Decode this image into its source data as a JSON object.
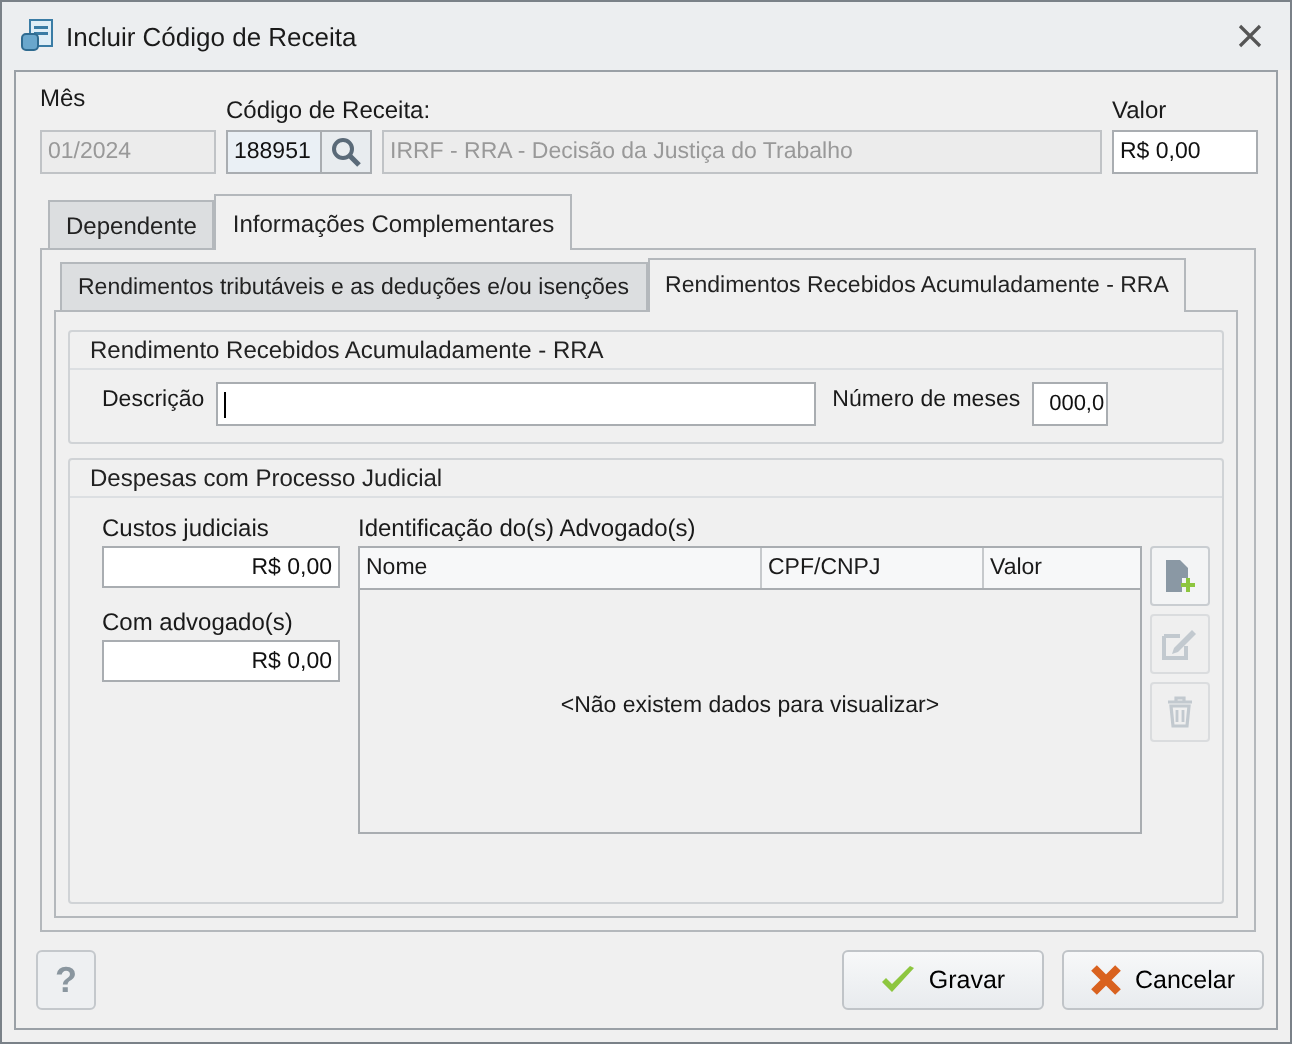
{
  "window": {
    "title": "Incluir Código de Receita"
  },
  "header": {
    "mes": {
      "label": "Mês",
      "value": "01/2024",
      "disabled": true
    },
    "codigo": {
      "label": "Código de Receita:",
      "value": "188951",
      "description": "IRRF - RRA - Decisão da Justiça do Trabalho",
      "description_disabled": true
    },
    "valor": {
      "label": "Valor",
      "value": "R$ 0,00"
    }
  },
  "tabs": [
    {
      "label": "Dependente",
      "selected": false
    },
    {
      "label": "Informações Complementares",
      "selected": true
    }
  ],
  "subtabs": [
    {
      "label": "Rendimentos tributáveis e as deduções e/ou isenções",
      "selected": false
    },
    {
      "label": "Rendimentos Recebidos Acumuladamente - RRA",
      "selected": true
    }
  ],
  "rra_group": {
    "title": "Rendimento Recebidos Acumuladamente - RRA",
    "descricao_label": "Descrição",
    "meses_label": "Número de meses",
    "meses_value": "000,0"
  },
  "despesas_group": {
    "title": "Despesas com Processo Judicial",
    "custos": {
      "label": "Custos judiciais",
      "value": "R$ 0,00"
    },
    "advogado": {
      "label": "Com advogado(s)",
      "value": "R$ 0,00"
    },
    "table": {
      "title": "Identificação do(s) Advogado(s)",
      "columns": [
        "Nome",
        "CPF/CNPJ",
        "Valor"
      ],
      "empty_message": "<Não existem dados para visualizar>"
    },
    "actions": [
      {
        "kind": "add",
        "disabled": false
      },
      {
        "kind": "edit",
        "disabled": true
      },
      {
        "kind": "delete",
        "disabled": true
      }
    ]
  },
  "footer": {
    "help": "?",
    "buttons": [
      {
        "kind": "save",
        "label": "Gravar"
      },
      {
        "kind": "cancel",
        "label": "Cancelar"
      }
    ]
  }
}
